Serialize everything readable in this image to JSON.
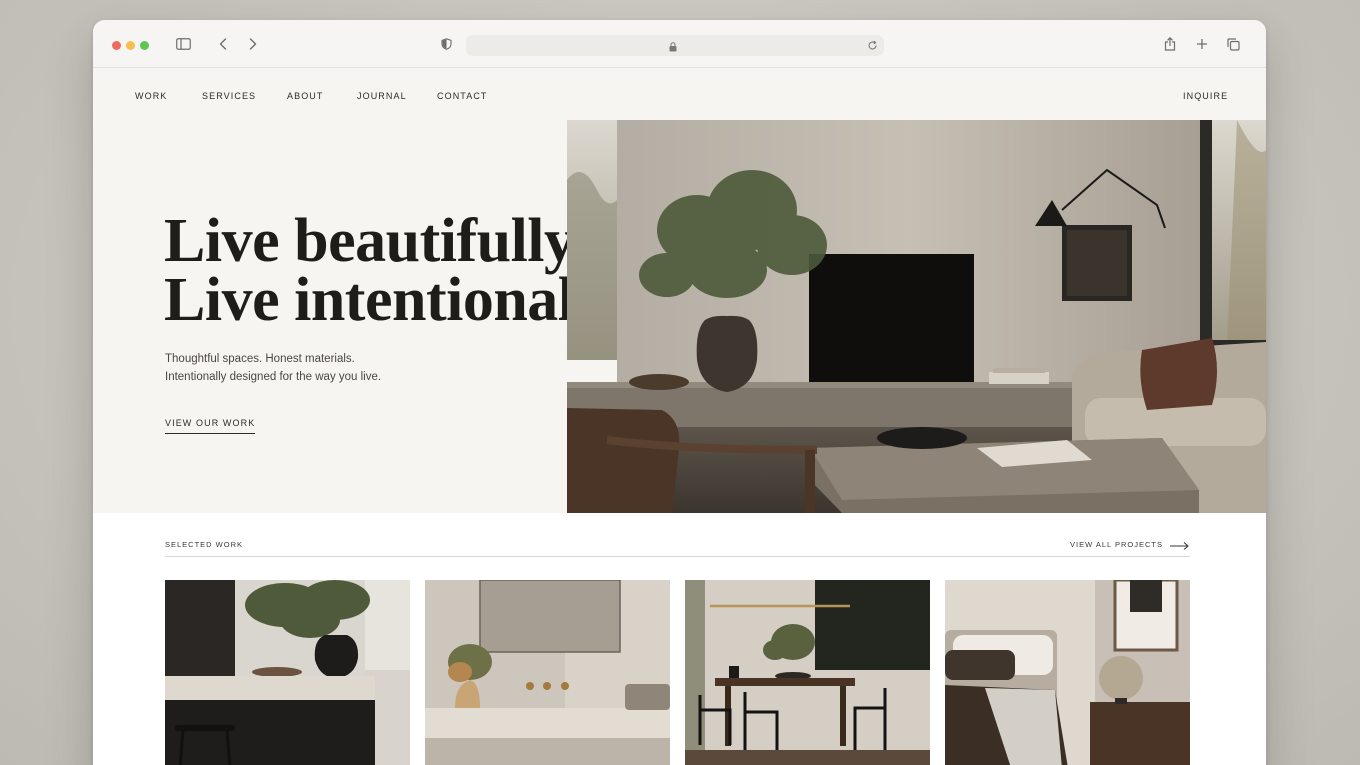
{
  "browser": {
    "traffic_lights": [
      "close",
      "minimize",
      "zoom"
    ],
    "icons": [
      "sidebar-icon",
      "back-icon",
      "forward-icon",
      "shield-icon",
      "lock-icon",
      "reload-icon",
      "share-icon",
      "new-tab-icon",
      "tabs-overview-icon"
    ]
  },
  "nav": {
    "items": [
      "WORK",
      "SERVICES",
      "ABOUT",
      "JOURNAL",
      "CONTACT"
    ],
    "inquire": "INQUIRE"
  },
  "hero": {
    "line1": "Live beautifully.",
    "line2": "Live intentionally.",
    "sub1": "Thoughtful spaces. Honest materials.",
    "sub2": "Intentionally designed for the way you live.",
    "cta": "VIEW OUR WORK"
  },
  "selected_work": {
    "label": "SELECTED WORK",
    "view_all": "VIEW ALL PROJECTS",
    "projects": [
      "kitchen",
      "bathroom",
      "dining room",
      "bedroom"
    ]
  },
  "colors": {
    "page_bg": "#f6f5f2",
    "text_dark": "#1f1d1a",
    "accent_stone": "#8a8176"
  }
}
